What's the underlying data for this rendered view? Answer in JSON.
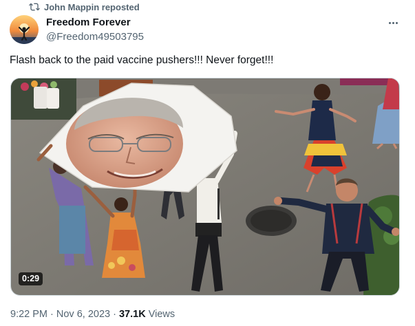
{
  "repost": {
    "icon": "repost-icon",
    "label": "John Mappin reposted"
  },
  "author": {
    "display_name": "Freedom Forever",
    "handle": "@Freedom49503795",
    "avatar_icon": "avatar-image"
  },
  "more_icon": "more-options-icon",
  "tweet": {
    "text": "Flash back to the paid vaccine pushers!!! Never forget!!!"
  },
  "media": {
    "duration": "0:29",
    "type": "video"
  },
  "meta": {
    "time": "9:22 PM",
    "sep1": " · ",
    "date": "Nov 6, 2023",
    "sep2": " · ",
    "views_count": "37.1K",
    "views_label": " Views"
  },
  "colors": {
    "text_primary": "#0f1419",
    "text_secondary": "#536471",
    "border": "#cfd9de"
  }
}
